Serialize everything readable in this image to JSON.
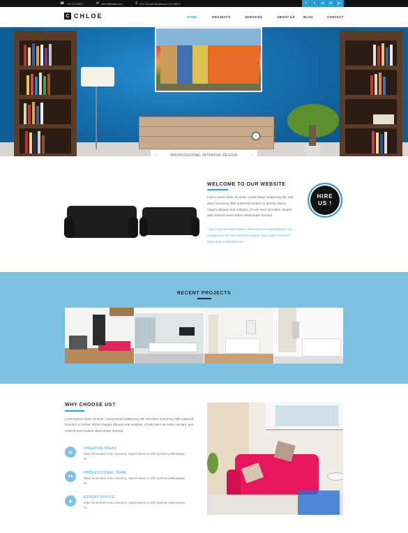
{
  "topbar": {
    "phone": "123 123 5567",
    "email": "admin@mail.com",
    "address": "874 Sunset Boulevard CA 78879",
    "social_icons": [
      "facebook-icon",
      "twitter-icon",
      "instagram-icon",
      "linkedin-icon",
      "google-plus-icon"
    ],
    "social_glyphs": [
      "f",
      "t",
      "◘",
      "in",
      "g+"
    ]
  },
  "brand": {
    "mark": "C",
    "name": "CHLOE"
  },
  "nav": [
    "HOME",
    "PROJECTS",
    "SERVICES",
    "ABOUT US",
    "BLOG",
    "CONTACT"
  ],
  "hero": {
    "caption": "PROFESSIONAL INTERIOR DESIGN",
    "prev_arrow": "‹",
    "next_arrow": "›"
  },
  "welcome": {
    "title": "WELCOME TO OUR WEBSITE",
    "body": "Lorem ipsum dolor sit amet, consectetuer adipiscing elit, sed diam nonummy nibh euismod tincidunt ut laoreet dolore magna aliquam erat volutpat. Ut wisi enim ad minim veniam, quis nostrud exerci tation ullamcorper suscipit",
    "quote": "\" Quis nostrud exerci tation ullamcorper suscipit lobortis nisl ut aliquip ex ea commodo consequat. Duis autem vel eum iriure dolor in hendrerit in \"",
    "hire_line1": "HIRE",
    "hire_line2": "US !"
  },
  "projects": {
    "title": "RECENT PROJECTS"
  },
  "why": {
    "title": "WHY CHOOSE US?",
    "body": "Lorem ipsum dolor sit amet, consectetuer adipiscing elit, sed diam nonummy nibh euismod tincidunt ut laoreet dolore magna aliquam erat volutpat. Ut wisi enim ad minim veniam, quis nostrud exerci tation ullamcorper suscipit",
    "features": [
      {
        "icon": "document-icon",
        "glyph": "▤",
        "title": "CREATIVE IDEAS",
        "text": "Etiam fermentum nunc nonummy. Urgent tamen et nihil reprehen pellentesque eu"
      },
      {
        "icon": "team-icon",
        "glyph": "●●",
        "title": "PROFESSIONAL TEAM",
        "text": "Etiam fermentum nunc nonummy. Urgent tamen et nihil reprehen pellentesque eu"
      },
      {
        "icon": "chat-icon",
        "glyph": "◉",
        "title": "EXPERT ADVICE",
        "text": "Etiam fermentum nunc nonummy. Urgent tamen et nihil reprehen pellentesque eu"
      }
    ]
  },
  "colors": {
    "accent": "#2a9fd6",
    "projects_band": "#7ec2df",
    "dark": "#111111"
  }
}
